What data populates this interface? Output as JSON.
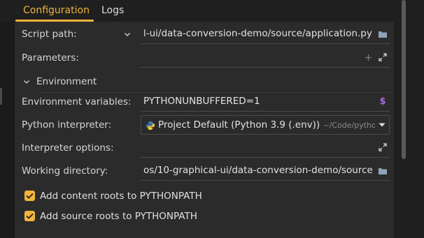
{
  "tabs": [
    {
      "label": "Configuration",
      "active": true
    },
    {
      "label": "Logs",
      "active": false
    }
  ],
  "fields": {
    "script_path": {
      "label": "Script path:",
      "value": "l-ui/data-conversion-demo/source/application.py",
      "icons": [
        "chevron-down-icon",
        "folder-icon"
      ]
    },
    "parameters": {
      "label": "Parameters:",
      "value": "",
      "icons": [
        "plus-icon",
        "expand-icon"
      ]
    },
    "environment_section": {
      "label": "Environment",
      "expanded": true
    },
    "env_vars": {
      "label": "Environment variables:",
      "value": "PYTHONUNBUFFERED=1",
      "icons": [
        "dollar-icon"
      ]
    },
    "interpreter": {
      "label": "Python interpreter:",
      "value": "Project Default (Python 3.9 (.env))",
      "path_hint": "~/Code/python",
      "icons": [
        "python-icon",
        "dropdown-arrow-icon"
      ]
    },
    "interpreter_options": {
      "label": "Interpreter options:",
      "value": "",
      "icons": [
        "expand-icon"
      ]
    },
    "working_dir": {
      "label": "Working directory:",
      "value": "os/10-graphical-ui/data-conversion-demo/source",
      "icons": [
        "folder-icon"
      ]
    }
  },
  "checkboxes": [
    {
      "label": "Add content roots to PYTHONPATH",
      "checked": true
    },
    {
      "label": "Add source roots to PYTHONPATH",
      "checked": true
    }
  ],
  "colors": {
    "accent": "#f0b43a",
    "panel": "#2b2b2b",
    "background": "#1f1f1f",
    "dollar": "#a76ddb"
  }
}
